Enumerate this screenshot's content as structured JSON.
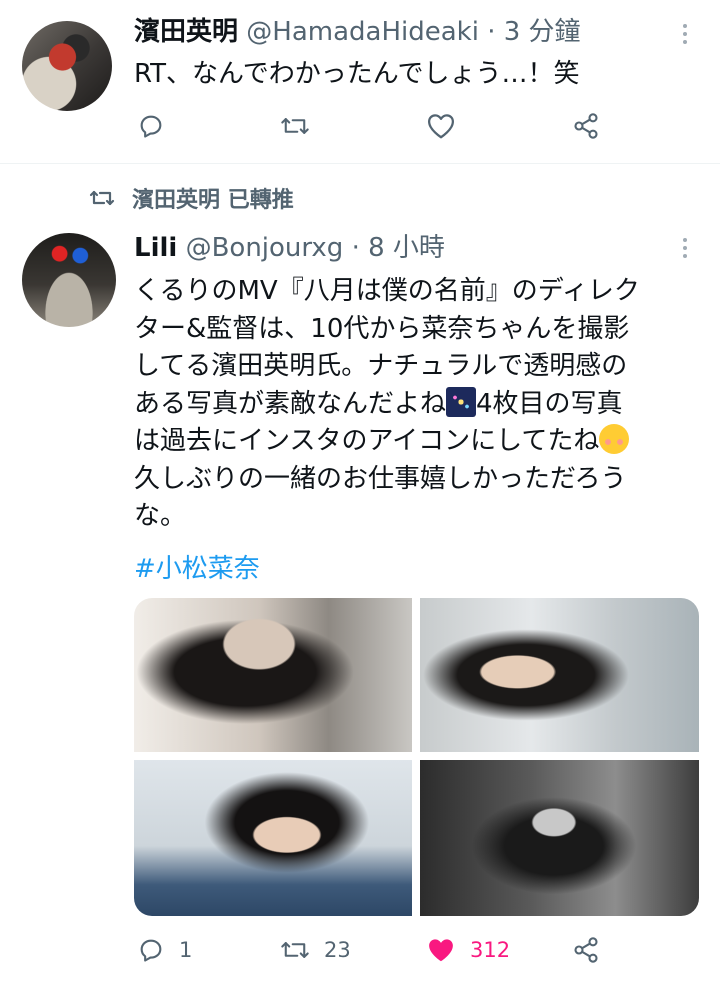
{
  "tweet1": {
    "display_name": "濱田英明",
    "handle": "@HamadaHideaki",
    "separator": "·",
    "time": "3 分鐘",
    "text": "RT、なんでわかったんでしょう…！笑"
  },
  "retweet_label": {
    "name": "濱田英明",
    "action": "已轉推"
  },
  "tweet2": {
    "display_name": "Lili",
    "handle": "@Bonjourxg",
    "separator": "·",
    "time": "8 小時",
    "lines": [
      "くるりのMV『八月は僕の名前』のディレク",
      "ター&監督は、10代から菜奈ちゃんを撮影",
      "してる濱田英明氏。ナチュラルで透明感の"
    ],
    "line4_before": "ある写真が素敵なんだよね",
    "line4_after": "4枚目の写真",
    "line5_before": "は過去にインスタのアイコンにしてたね",
    "lines_end": [
      "久しぶりの一緒のお仕事嬉しかっただろう",
      "な。"
    ],
    "hashtag": "#小松菜奈",
    "reply_count": "1",
    "retweet_count": "23",
    "like_count": "312"
  },
  "icons": {
    "reply": "reply-icon",
    "retweet": "retweet-icon",
    "like": "heart-icon",
    "share": "share-icon",
    "more": "more-icon",
    "emoji_fireworks": "fireworks-emoji-icon",
    "emoji_smile": "smiling-face-emoji-icon"
  },
  "colors": {
    "accent": "#1d9bf0",
    "like": "#f91880",
    "muted": "#536471"
  }
}
